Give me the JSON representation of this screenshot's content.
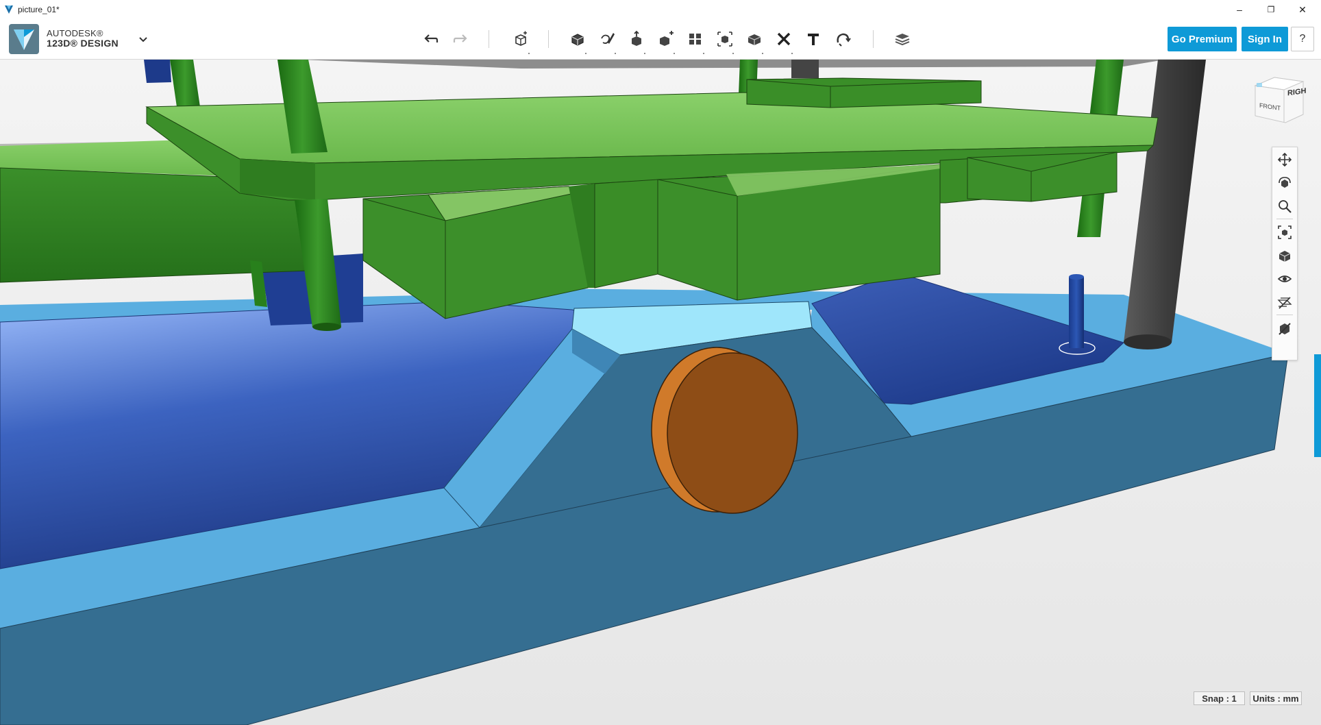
{
  "window": {
    "title": "picture_01*",
    "controls": {
      "minimize": "–",
      "restore": "❐",
      "close": "✕"
    }
  },
  "brand": {
    "line1": "AUTODESK®",
    "line2": "123D® DESIGN"
  },
  "toolbar": {
    "tools": [
      "undo-icon",
      "redo-icon",
      "transform-icon",
      "primitives-icon",
      "sketch-icon",
      "construct-icon",
      "modify-icon",
      "pattern-icon",
      "group-icon",
      "combine-icon",
      "delete-icon",
      "text-icon",
      "snap-icon",
      "material-icon"
    ],
    "go_premium": "Go Premium",
    "sign_in": "Sign In",
    "help": "?"
  },
  "viewcube": {
    "face_front": "FRONT",
    "face_right": "RIGHT"
  },
  "nav_tools": [
    "pan-icon",
    "orbit-icon",
    "zoom-icon",
    "fit-icon",
    "view-mode-icon",
    "visibility-icon",
    "grid-icon",
    "material-visibility-icon"
  ],
  "status": {
    "snap": "Snap : 1",
    "units": "Units : mm"
  },
  "colors": {
    "accent": "#0e9ad7",
    "green_top": "#84c564",
    "green_side": "#2e7d1f",
    "blue_light": "#5aaee0",
    "blue_dark": "#356e91",
    "blue_trough": "#2c4c9f",
    "orange": "#8e4d16",
    "gray_post": "#4a4a4a"
  }
}
